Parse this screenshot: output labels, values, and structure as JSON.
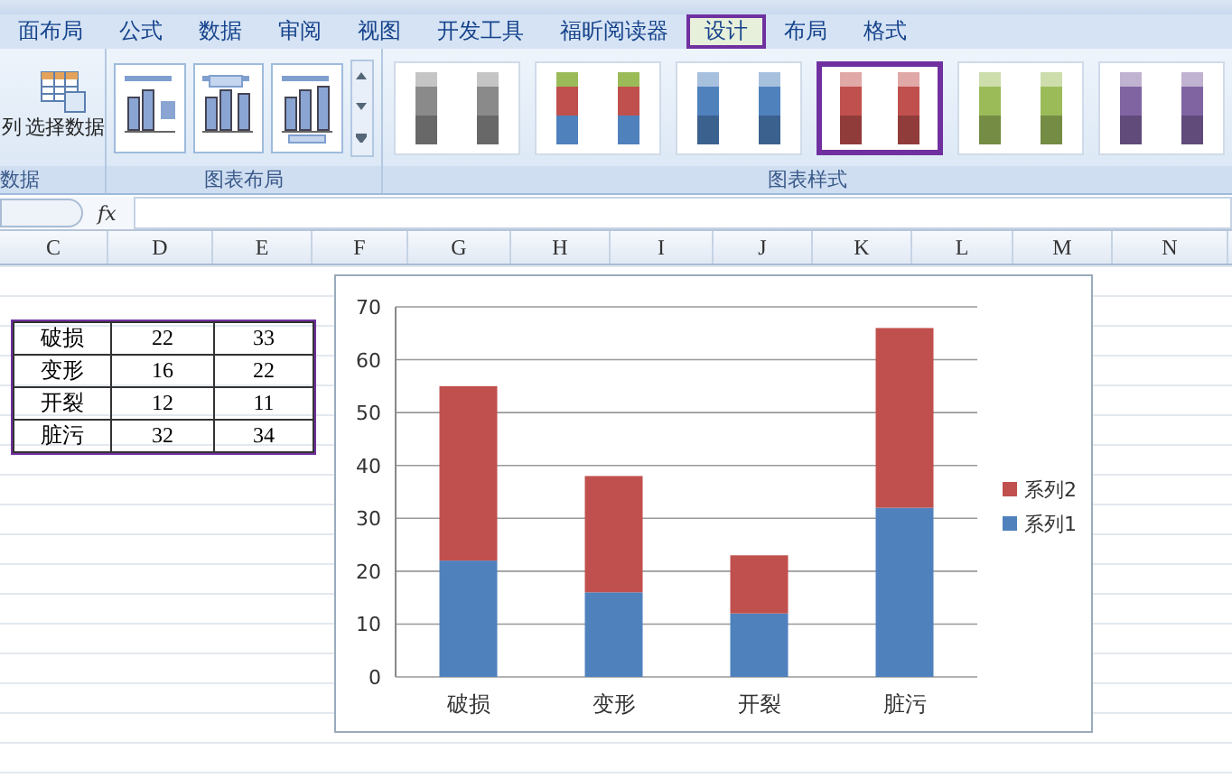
{
  "tabs": [
    {
      "label": "面布局",
      "selected": false
    },
    {
      "label": "公式",
      "selected": false
    },
    {
      "label": "数据",
      "selected": false
    },
    {
      "label": "审阅",
      "selected": false
    },
    {
      "label": "视图",
      "selected": false
    },
    {
      "label": "开发工具",
      "selected": false
    },
    {
      "label": "福昕阅读器",
      "selected": false
    },
    {
      "label": "设计",
      "selected": true
    },
    {
      "label": "布局",
      "selected": false
    },
    {
      "label": "格式",
      "selected": false
    }
  ],
  "ribbon": {
    "data_group": {
      "label": "数据",
      "cut_label": "列",
      "button": "选择数据"
    },
    "layout_group": {
      "label": "图表布局",
      "layouts": [
        {
          "kind": "legend"
        },
        {
          "kind": "titled"
        },
        {
          "kind": "table"
        }
      ]
    },
    "style_group": {
      "label": "图表样式",
      "styles": [
        {
          "kind": "mono",
          "color": "#8a8a8a",
          "selected": false
        },
        {
          "kind": "multi",
          "color": "#c0504d",
          "selected": false
        },
        {
          "kind": "mono",
          "color": "#4f81bd",
          "selected": false
        },
        {
          "kind": "mono",
          "color": "#c0504d",
          "selected": true
        },
        {
          "kind": "mono",
          "color": "#9bbb59",
          "selected": false
        },
        {
          "kind": "mono",
          "color": "#8064a2",
          "selected": false
        }
      ]
    }
  },
  "formula_bar": {
    "fx": "fx"
  },
  "columns": [
    "C",
    "D",
    "E",
    "F",
    "G",
    "H",
    "I",
    "J",
    "K",
    "L",
    "M",
    "N"
  ],
  "table": [
    [
      "破损",
      "22",
      "33"
    ],
    [
      "变形",
      "16",
      "22"
    ],
    [
      "开裂",
      "12",
      "11"
    ],
    [
      "脏污",
      "32",
      "34"
    ]
  ],
  "chart": {
    "chart_data": {
      "type": "bar",
      "stacked": true,
      "categories": [
        "破损",
        "变形",
        "开裂",
        "脏污"
      ],
      "series": [
        {
          "name": "系列1",
          "color": "#4f81bd",
          "values": [
            22,
            16,
            12,
            32
          ]
        },
        {
          "name": "系列2",
          "color": "#c0504d",
          "values": [
            33,
            22,
            11,
            34
          ]
        }
      ],
      "ylim": [
        0,
        70
      ],
      "yticks": [
        0,
        10,
        20,
        30,
        40,
        50,
        60,
        70
      ],
      "grid": true,
      "legend": true
    }
  }
}
